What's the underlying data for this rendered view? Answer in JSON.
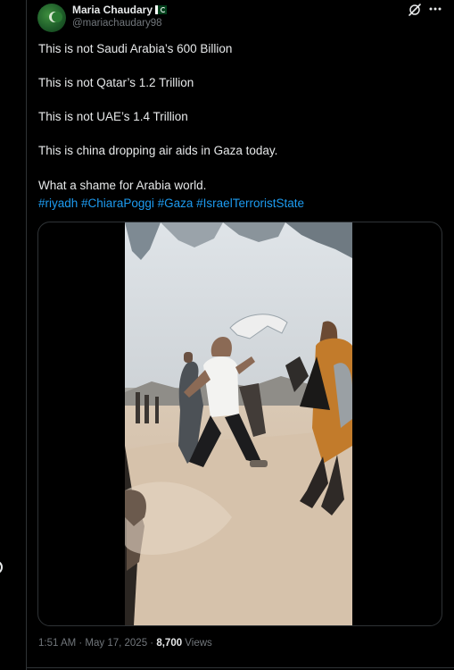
{
  "author": {
    "display_name": "Maria Chaudary",
    "handle": "@mariachaudary98"
  },
  "post": {
    "lines": [
      "This is not Saudi Arabia’s 600 Billion",
      "This is not Qatar’s 1.2 Trillion",
      "This is not UAE’s 1.4 Trillion",
      "This is china dropping air aids in Gaza today.",
      "What a shame for Arabia world."
    ],
    "hashtags": [
      "#riyadh",
      "#ChiaraPoggi",
      "#Gaza",
      "#IsraelTerroristState"
    ]
  },
  "meta": {
    "timestamp": "1:51 AM · May 17, 2025 · ",
    "views_count": "8,700",
    "views_label": " Views"
  },
  "icons": {
    "grok": "grok-icon",
    "more": "more-icon",
    "flag": "pakistan-flag-icon"
  },
  "colors": {
    "background": "#000000",
    "text": "#e7e9ea",
    "muted": "#71767b",
    "link": "#1d9bf0",
    "border": "#2f3336"
  }
}
